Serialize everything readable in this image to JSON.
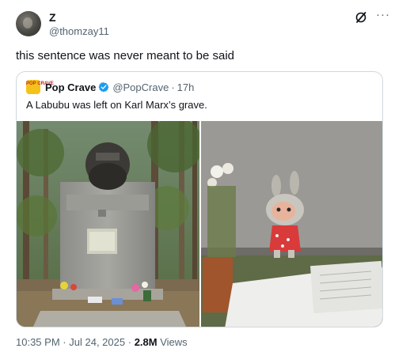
{
  "tweet": {
    "author_name": "Z",
    "author_handle": "@thomzay11",
    "text": "this sentence was never meant to be said",
    "more_label": "···"
  },
  "quote": {
    "avatar_text": "POP CRAVE",
    "author_name": "Pop Crave",
    "author_handle": "@PopCrave",
    "separator": "·",
    "time": "17h",
    "text": "A Labubu was left on Karl Marx’s grave."
  },
  "footer": {
    "time": "10:35 PM",
    "separator1": "·",
    "date": "Jul 24, 2025",
    "separator2": "·",
    "views_count": "2.8M",
    "views_label": "Views"
  },
  "colors": {
    "text": "#0f1419",
    "secondary": "#536471",
    "border": "#cfd9de",
    "verified": "#1d9bf0",
    "pop_crave_bg": "#f5c21b"
  },
  "icons": {
    "grok": "grok-icon",
    "more": "more-icon",
    "verified": "verified-badge-icon"
  }
}
